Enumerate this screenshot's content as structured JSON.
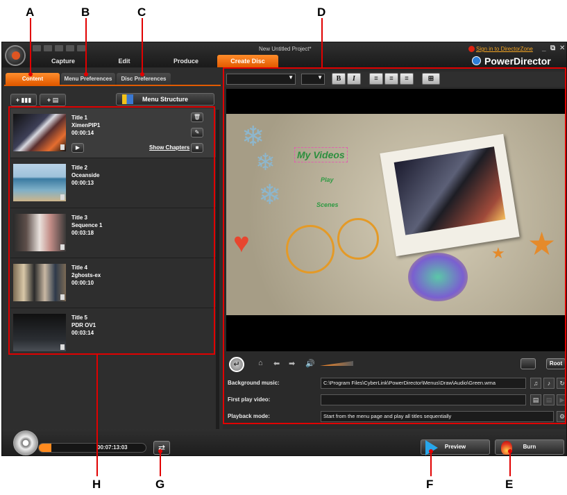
{
  "callouts": {
    "A": "A",
    "B": "B",
    "C": "C",
    "D": "D",
    "E": "E",
    "F": "F",
    "G": "G",
    "H": "H"
  },
  "titlebar": {
    "window_title": "New Untitled Project*",
    "signin": "Sign in to DirectorZone",
    "minimize": "_",
    "restore": "⧉",
    "close": "✕",
    "modes": [
      "Capture",
      "Edit",
      "Produce",
      "Create Disc"
    ],
    "active_mode": "Create Disc",
    "product": "PowerDirector"
  },
  "subtabs": [
    "Content",
    "Menu Preferences",
    "Disc Preferences"
  ],
  "content_toolbar": {
    "add_title": "+",
    "add_playlist": "+",
    "menu_structure": "Menu Structure"
  },
  "titles": [
    {
      "title": "Title 1",
      "name": "XimenPIP1",
      "duration": "00:00:14"
    },
    {
      "title": "Title 2",
      "name": "Oceanside",
      "duration": "00:00:13"
    },
    {
      "title": "Title 3",
      "name": "Sequence 1",
      "duration": "00:03:18"
    },
    {
      "title": "Title 4",
      "name": "2ghosts-ex",
      "duration": "00:00:10"
    },
    {
      "title": "Title 5",
      "name": "PDR OV1",
      "duration": "00:03:14"
    }
  ],
  "show_chapters": "Show Chapters",
  "format": {
    "bold": "B",
    "italic": "I"
  },
  "menu_preview": {
    "title": "My Videos",
    "play": "Play",
    "scenes": "Scenes"
  },
  "transport": {
    "root": "Root",
    "back": "↵"
  },
  "fields": {
    "background_music": {
      "label": "Background music:",
      "value": "C:\\Program Files\\CyberLink\\PowerDirector\\Menus\\Draw\\Audio\\Green.wma"
    },
    "first_play_video": {
      "label": "First play video:",
      "value": ""
    },
    "playback_mode": {
      "label": "Playback mode:",
      "value": "Start from the menu page and play all titles sequentially"
    }
  },
  "bottom": {
    "disc_time": "00:07:13:03",
    "capacity_fraction": 0.12,
    "preview": "Preview",
    "burn": "Burn"
  },
  "colors": {
    "accent": "#ff7a10",
    "callout_red": "#e10000"
  }
}
